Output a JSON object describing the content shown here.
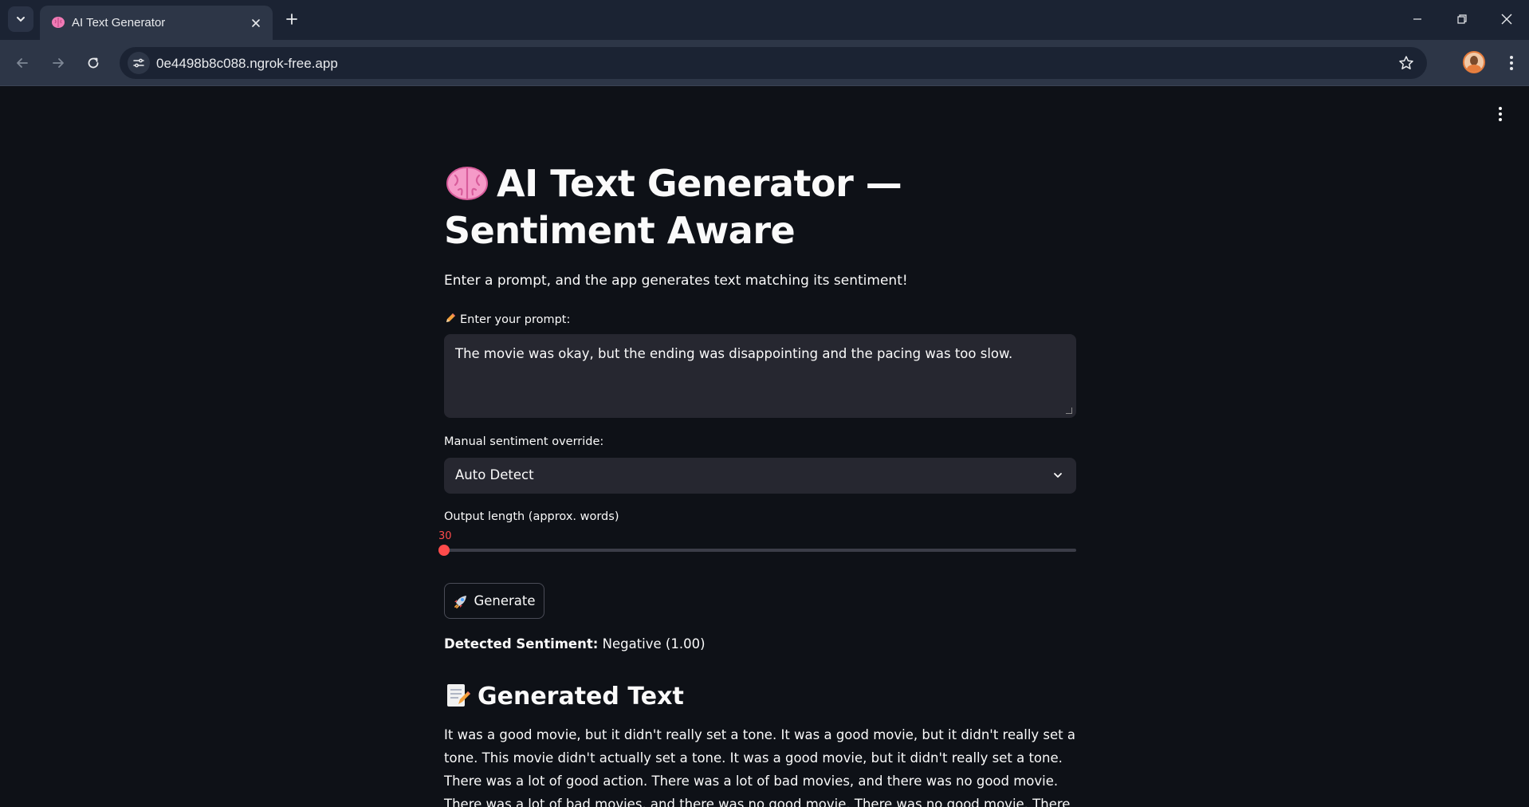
{
  "browser": {
    "tab_title": "AI Text Generator",
    "url": "0e4498b8c088.ngrok-free.app"
  },
  "app": {
    "title": "AI Text Generator — Sentiment Aware",
    "subtitle": "Enter a prompt, and the app generates text matching its sentiment!",
    "prompt_label": "Enter your prompt:",
    "prompt_value": "The movie was okay, but the ending was disappointing and the pacing was too slow.",
    "override_label": "Manual sentiment override:",
    "override_value": "Auto Detect",
    "length_label": "Output length (approx. words)",
    "length_value": "30",
    "length_fraction": 0.0,
    "generate_label": "Generate",
    "detected_label": "Detected Sentiment:",
    "detected_value": "Negative (1.00)",
    "generated_heading": "Generated Text",
    "generated_text": "It was a good movie, but it didn't really set a tone. It was a good movie, but it didn't really set a tone. This movie didn't actually set a tone. It was a good movie, but it didn't really set a tone. There was a lot of good action. There was a lot of bad movies, and there was no good movie. There was a lot of bad movies, and there was no good movie. There was no good movie. There was no good movie. There was no good movie."
  },
  "colors": {
    "accent": "#ff4b4b",
    "background": "#0e1117",
    "input_bg": "#262730"
  }
}
